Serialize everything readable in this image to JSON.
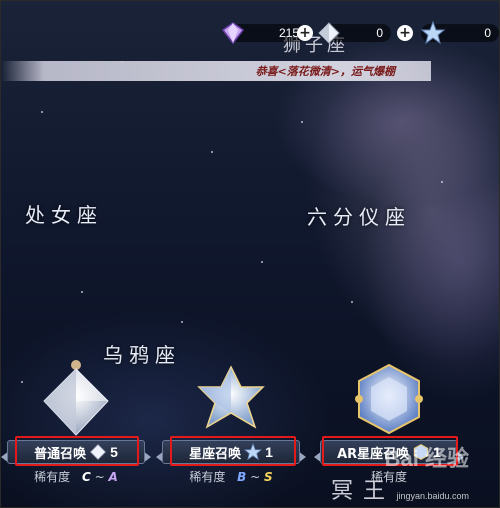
{
  "currencies": [
    {
      "name": "diamond",
      "value": "215",
      "icon": "purple-diamond-icon"
    },
    {
      "name": "crystal",
      "value": "0",
      "icon": "white-crystal-icon"
    },
    {
      "name": "star",
      "value": "0",
      "icon": "star-crystal-icon"
    }
  ],
  "top_title": "狮子座",
  "banner_text": "恭喜<落花微清>，运气爆棚",
  "constellations": {
    "virgo": "处女座",
    "sextans": "六分仪座",
    "corvus": "乌鸦座",
    "bottom": "冥王"
  },
  "summons": [
    {
      "label": "普通召唤",
      "cost": "5",
      "cost_icon": "white-crystal-icon",
      "rarity_label": "稀有度",
      "rarity_from": "C",
      "rarity_sep": "~",
      "rarity_to": "A"
    },
    {
      "label": "星座召唤",
      "cost": "1",
      "cost_icon": "star-crystal-icon",
      "rarity_label": "稀有度",
      "rarity_from": "B",
      "rarity_sep": "~",
      "rarity_to": "S"
    },
    {
      "label": "AR星座召唤",
      "cost": "1",
      "cost_icon": "ar-crystal-icon",
      "rarity_label": "稀有度",
      "rarity_from": "",
      "rarity_sep": "",
      "rarity_to": ""
    }
  ],
  "watermark": {
    "big": "Bai 经验",
    "small": "jingyan.baidu.com"
  },
  "colors": {
    "highlight_box": "#e41a1a",
    "rarity_C": "#ffffff",
    "rarity_A": "#c9a6f2",
    "rarity_B": "#7ea8ff",
    "rarity_S": "#f5d35a"
  }
}
